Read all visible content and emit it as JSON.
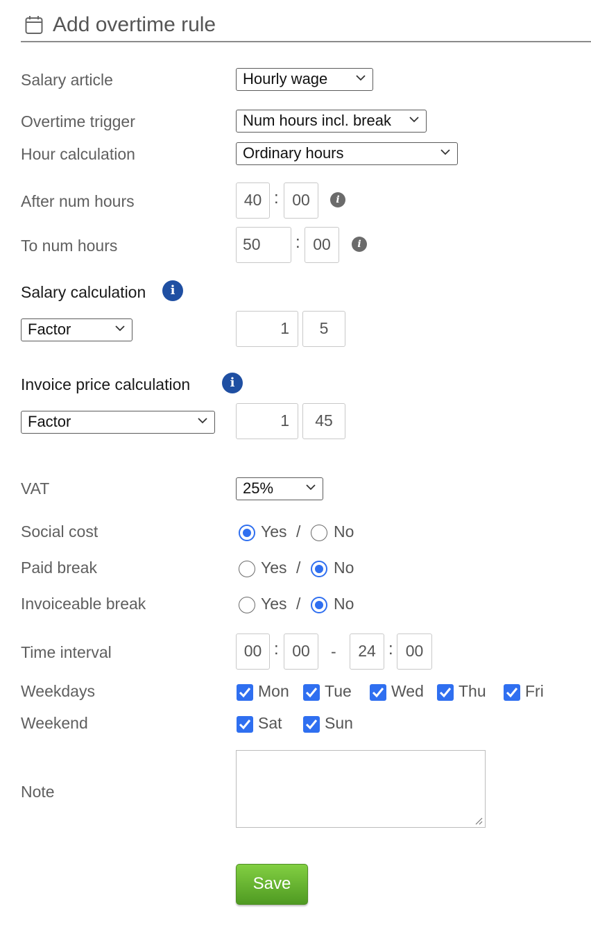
{
  "header": {
    "title": "Add overtime rule",
    "icon": "calendar-icon"
  },
  "salary_article": {
    "label": "Salary article",
    "value": "Hourly wage"
  },
  "overtime_trigger": {
    "label": "Overtime trigger",
    "value": "Num hours incl. break"
  },
  "hour_calculation": {
    "label": "Hour calculation",
    "value": "Ordinary hours"
  },
  "after_num_hours": {
    "label": "After num hours",
    "hours": "40",
    "minutes": "00",
    "sep": ":"
  },
  "to_num_hours": {
    "label": "To num hours",
    "hours": "50",
    "minutes": "00",
    "sep": ":"
  },
  "salary_calculation": {
    "label": "Salary calculation",
    "type": "Factor",
    "whole": "1",
    "decimal": "5"
  },
  "invoice_price_calculation": {
    "label": "Invoice price calculation",
    "type": "Factor",
    "whole": "1",
    "decimal": "45"
  },
  "vat": {
    "label": "VAT",
    "value": "25%"
  },
  "options": {
    "yes": "Yes",
    "no": "No",
    "sep": "/"
  },
  "social_cost": {
    "label": "Social cost",
    "selected": "Yes"
  },
  "paid_break": {
    "label": "Paid break",
    "selected": "No"
  },
  "invoiceable_break": {
    "label": "Invoiceable break",
    "selected": "No"
  },
  "time_interval": {
    "label": "Time interval",
    "from_hours": "00",
    "from_minutes": "00",
    "dash": "-",
    "to_hours": "24",
    "to_minutes": "00"
  },
  "weekdays": {
    "label": "Weekdays",
    "days": [
      "Mon",
      "Tue",
      "Wed",
      "Thu",
      "Fri"
    ],
    "checked": [
      true,
      true,
      true,
      true,
      true
    ]
  },
  "weekend": {
    "label": "Weekend",
    "days": [
      "Sat",
      "Sun"
    ],
    "checked": [
      true,
      true
    ]
  },
  "note": {
    "label": "Note",
    "value": ""
  },
  "save": {
    "label": "Save"
  },
  "colors": {
    "accent": "#2f6ff0",
    "info_blue": "#1f4fa2",
    "save_green": "#5aad2b"
  }
}
